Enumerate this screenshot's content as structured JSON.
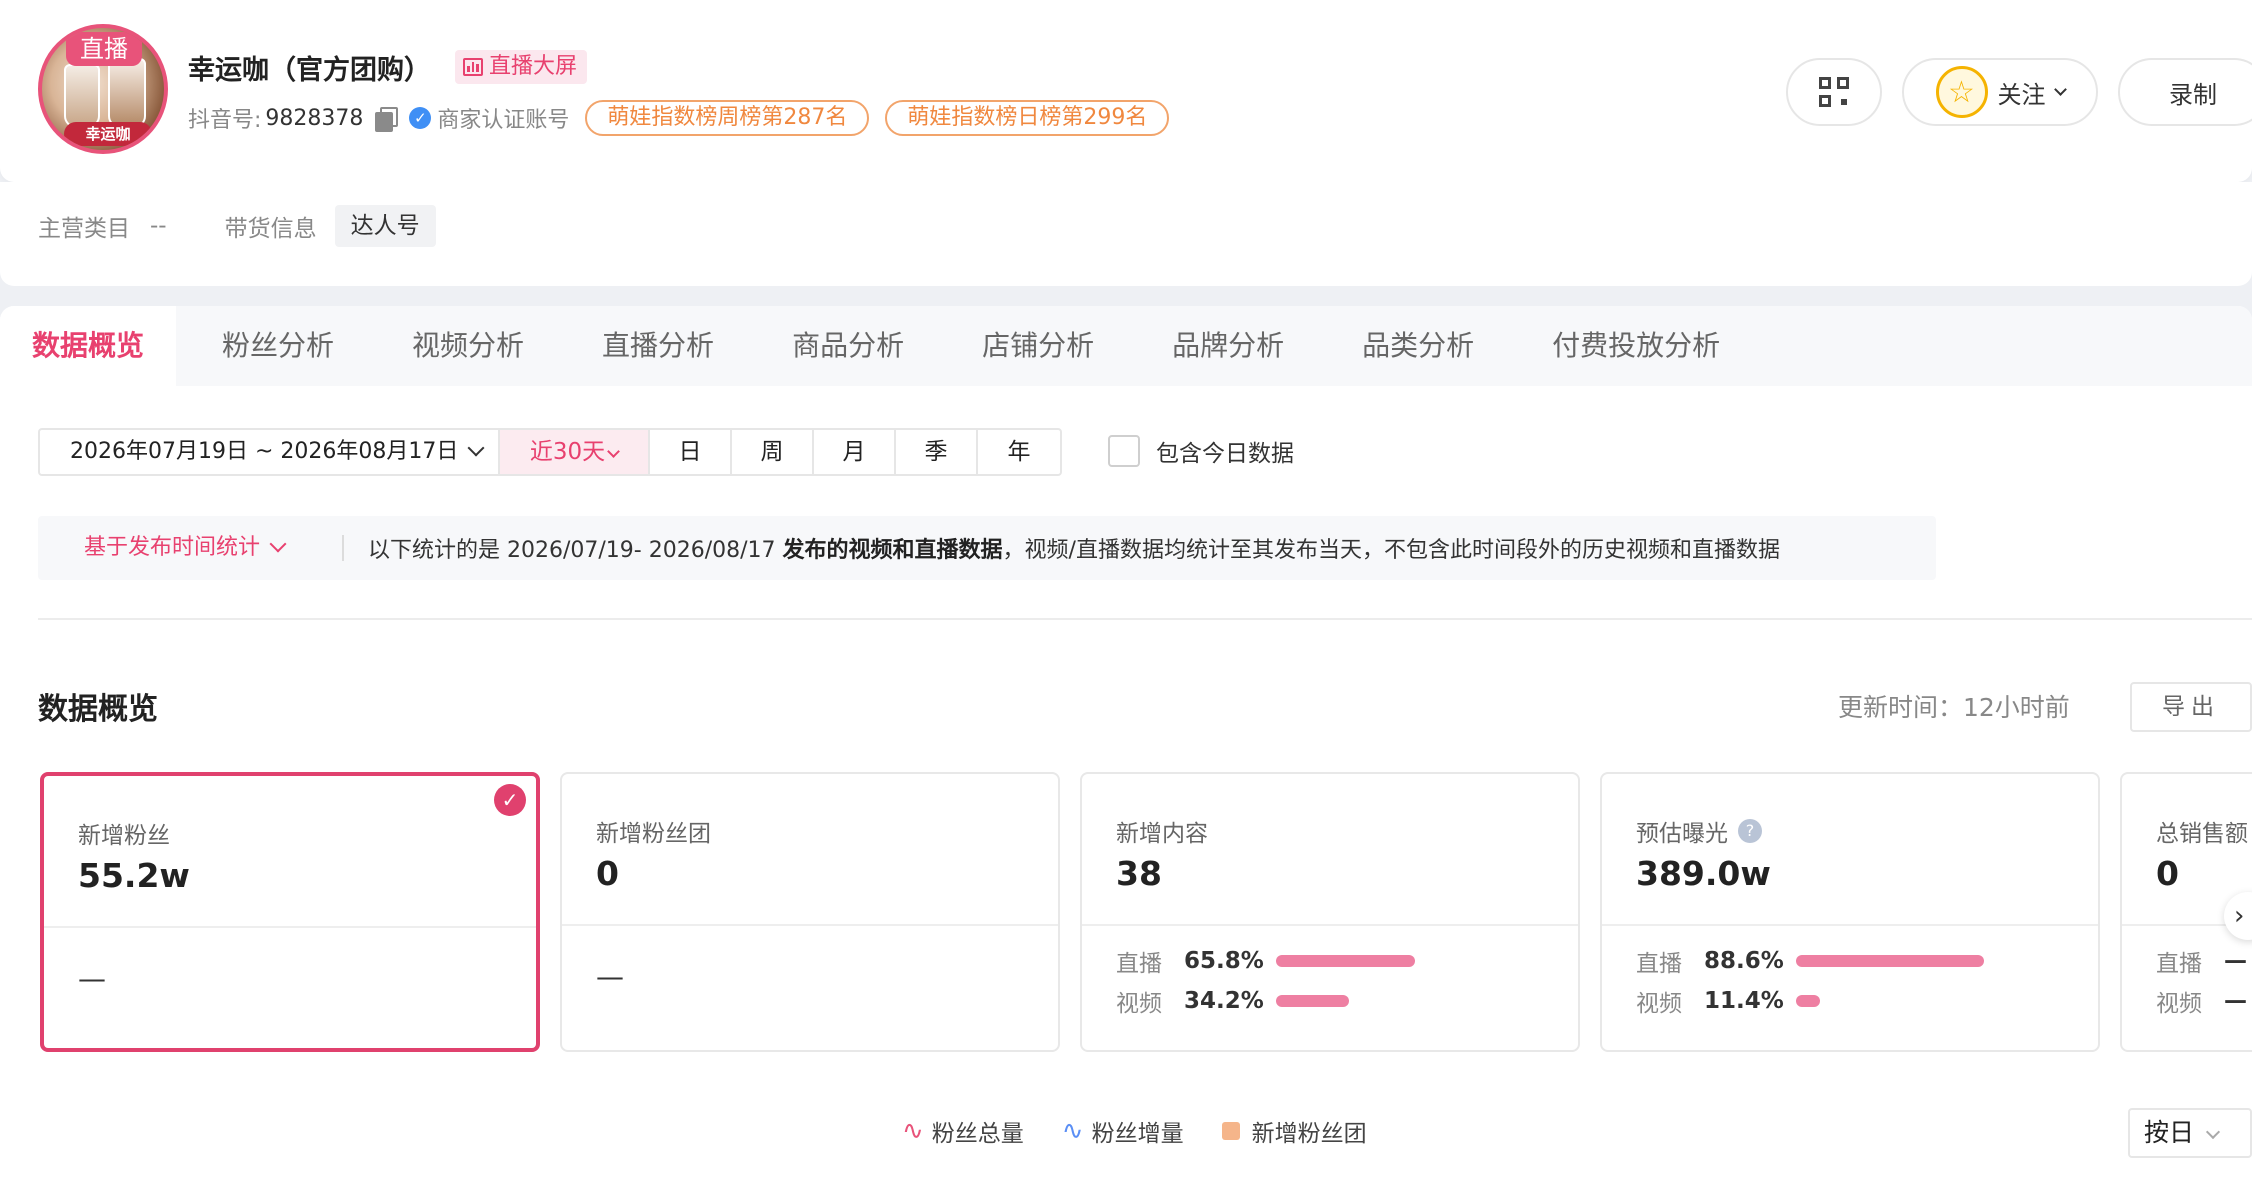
{
  "profile": {
    "avatar_live_label": "直播",
    "avatar_brand_label": "幸运咖",
    "name": "幸运咖（官方团购）",
    "big_screen_label": "直播大屏",
    "douyin_id_label": "抖音号:",
    "douyin_id": "9828378",
    "verified_label": "商家认证账号",
    "rank_weekly": "萌娃指数榜周榜第287名",
    "rank_daily": "萌娃指数榜日榜第299名",
    "follow_label": "关注",
    "record_label": "录制",
    "main_category_label": "主营类目",
    "main_category_value": "--",
    "goods_info_label": "带货信息",
    "goods_info_tag": "达人号"
  },
  "tabs": [
    {
      "label": "数据概览",
      "active": true
    },
    {
      "label": "粉丝分析",
      "active": false
    },
    {
      "label": "视频分析",
      "active": false
    },
    {
      "label": "直播分析",
      "active": false
    },
    {
      "label": "商品分析",
      "active": false
    },
    {
      "label": "店铺分析",
      "active": false
    },
    {
      "label": "品牌分析",
      "active": false
    },
    {
      "label": "品类分析",
      "active": false
    },
    {
      "label": "付费投放分析",
      "active": false
    }
  ],
  "filters": {
    "date_range": "2026年07月19日 ~ 2026年08月17日",
    "quick_range": "近30天",
    "periods": [
      "日",
      "周",
      "月",
      "季",
      "年"
    ],
    "include_today_label": "包含今日数据",
    "include_today_checked": false
  },
  "notice": {
    "basis_label": "基于发布时间统计",
    "prefix": "以下统计的是  2026/07/19- 2026/08/17 ",
    "bold": "发布的视频和直播数据",
    "suffix": "，视频/直播数据均统计至其发布当天，不包含此时间段外的历史视频和直播数据"
  },
  "overview": {
    "title": "数据概览",
    "update_time": "更新时间：12小时前",
    "export_label": "导出"
  },
  "metric_cards": [
    {
      "label": "新增粉丝",
      "value": "55.2w",
      "selected": true,
      "footer": "—"
    },
    {
      "label": "新增粉丝团",
      "value": "0",
      "selected": false,
      "footer": "—"
    },
    {
      "label": "新增内容",
      "value": "38",
      "selected": false,
      "breakdown": [
        {
          "label": "直播",
          "pct": "65.8%",
          "ratio": 0.658
        },
        {
          "label": "视频",
          "pct": "34.2%",
          "ratio": 0.342
        }
      ]
    },
    {
      "label": "预估曝光",
      "value": "389.0w",
      "selected": false,
      "help": true,
      "breakdown": [
        {
          "label": "直播",
          "pct": "88.6%",
          "ratio": 0.886
        },
        {
          "label": "视频",
          "pct": "11.4%",
          "ratio": 0.114
        }
      ]
    },
    {
      "label": "总销售额",
      "value": "0",
      "selected": false,
      "breakdown": [
        {
          "label": "直播",
          "pct": "—"
        },
        {
          "label": "视频",
          "pct": "—"
        }
      ]
    }
  ],
  "legend": [
    {
      "label": "粉丝总量",
      "color": "#e8537a",
      "shape": "wave"
    },
    {
      "label": "粉丝增量",
      "color": "#5b8ff5",
      "shape": "wave"
    },
    {
      "label": "新增粉丝团",
      "color": "#f5b58a",
      "shape": "square"
    }
  ],
  "granularity": "按日",
  "colors": {
    "accent": "#e8416f",
    "bar": "#ee7fa2",
    "rank_tag": "#f0883f"
  }
}
